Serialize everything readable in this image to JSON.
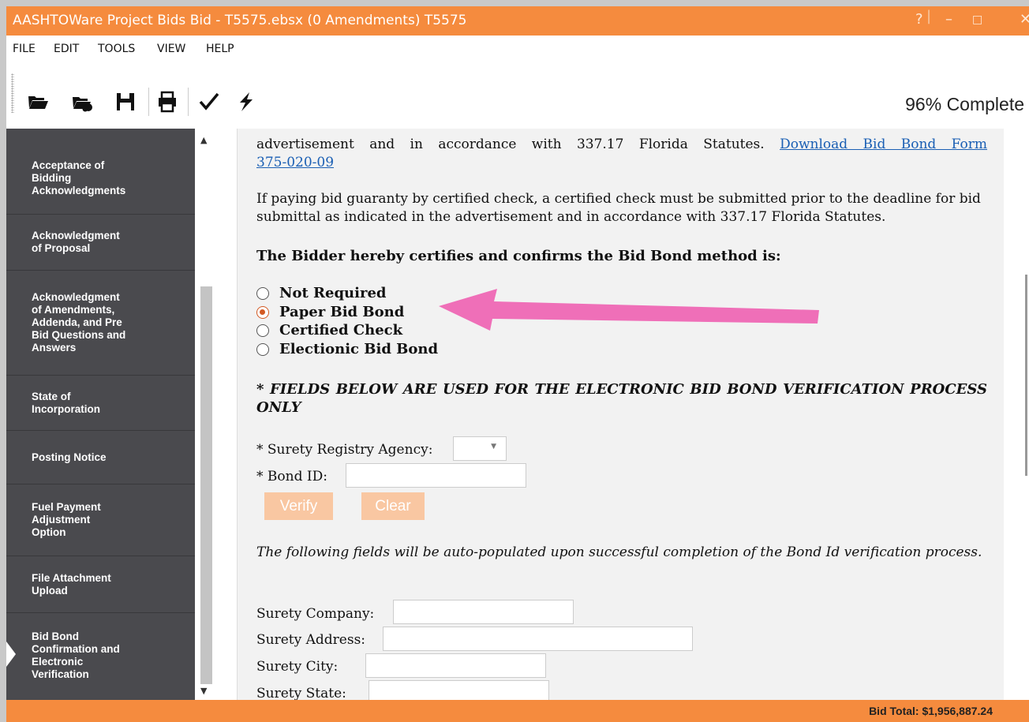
{
  "window": {
    "title": "AASHTOWare Project Bids Bid - T5575.ebsx (0 Amendments) T5575",
    "help_glyph": "?",
    "minimize_glyph": "–",
    "maximize_glyph": "□",
    "close_glyph": "✕"
  },
  "menu": [
    "FILE",
    "EDIT",
    "TOOLS",
    "VIEW",
    "HELP"
  ],
  "toolbar": {
    "progress": "96% Complete",
    "icons": [
      "open-folder-icon",
      "open-folder-cloud-icon",
      "save-icon",
      "print-icon",
      "check-icon",
      "lightning-icon"
    ]
  },
  "sidebar": {
    "items": [
      {
        "label": "Acceptance of\nBidding\nAcknowledgments"
      },
      {
        "label": "Acknowledgment\nof Proposal"
      },
      {
        "label": "Acknowledgment\nof Amendments,\nAddenda, and Pre\nBid Questions and\nAnswers"
      },
      {
        "label": "State of\nIncorporation"
      },
      {
        "label": "Posting Notice"
      },
      {
        "label": "Fuel Payment\nAdjustment\nOption"
      },
      {
        "label": "File Attachment\nUpload"
      },
      {
        "label": "Bid Bond\nConfirmation and\nElectronic\nVerification",
        "active": true
      }
    ]
  },
  "content": {
    "para1_line1_text": "advertisement and in accordance with 337.17 Florida Statutes.",
    "para1_link_part1": "Download Bid Bond Form",
    "para1_link_part2": "375-020-09",
    "para2": "If paying bid guaranty by certified check, a certified check must be submitted prior to the deadline for bid submittal as indicated in the advertisement and in accordance with 337.17 Florida Statutes.",
    "certify_heading": "The Bidder hereby certifies and confirms the Bid Bond method is:",
    "bond_options": [
      {
        "label": "Not Required",
        "selected": false
      },
      {
        "label": "Paper Bid Bond",
        "selected": true
      },
      {
        "label": "Certified Check",
        "selected": false
      },
      {
        "label": "Electionic Bid Bond",
        "selected": false
      }
    ],
    "fields_notice": "* FIELDS BELOW ARE USED FOR THE ELECTRONIC BID BOND VERIFICATION PROCESS ONLY",
    "surety_registry_label": "* Surety Registry Agency:",
    "surety_registry_value": "",
    "bond_id_label": "* Bond ID:",
    "bond_id_value": "",
    "verify_button": "Verify",
    "clear_button": "Clear",
    "auto_populate_note": "The following fields will be auto-populated upon successful completion of the Bond Id verification process.",
    "surety_company_label": "Surety Company:",
    "surety_address_label": "Surety Address:",
    "surety_city_label": "Surety City:",
    "surety_state_label": "Surety State:"
  },
  "annotation": {
    "arrow_color": "#ef6fb8"
  },
  "status": {
    "bid_total": "Bid Total: $1,956,887.24"
  }
}
